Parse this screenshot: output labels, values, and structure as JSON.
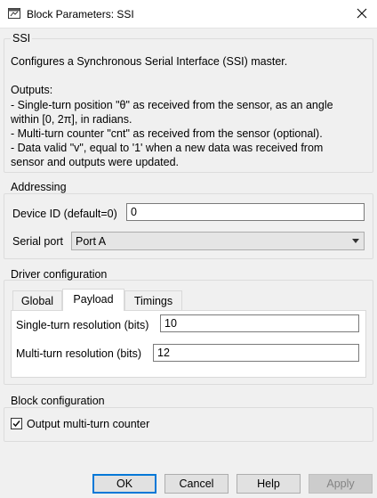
{
  "window": {
    "title": "Block Parameters: SSI",
    "icon": "simulink-block-icon",
    "close_icon": "close-icon"
  },
  "ssi": {
    "group_title": "SSI",
    "description": "Configures a Synchronous Serial Interface (SSI) master.\n\nOutputs:\n- Single-turn position \"θ\" as received from the sensor, as an angle\nwithin [0, 2π], in radians.\n- Multi-turn counter \"cnt\" as received from the sensor (optional).\n- Data valid \"v\", equal to '1' when a new data was received from\nsensor and outputs were updated."
  },
  "addressing": {
    "group_title": "Addressing",
    "device_id_label": "Device ID (default=0)",
    "device_id_value": "0",
    "serial_port_label": "Serial port",
    "serial_port_value": "Port A"
  },
  "driver": {
    "group_title": "Driver configuration",
    "tabs": [
      {
        "label": "Global",
        "active": false
      },
      {
        "label": "Payload",
        "active": true
      },
      {
        "label": "Timings",
        "active": false
      }
    ],
    "single_turn_label": "Single-turn resolution (bits)",
    "single_turn_value": "10",
    "multi_turn_label": "Multi-turn resolution (bits)",
    "multi_turn_value": "12"
  },
  "block_config": {
    "group_title": "Block configuration",
    "output_multiturn_label": "Output multi-turn counter",
    "output_multiturn_checked": true
  },
  "buttons": {
    "ok": "OK",
    "cancel": "Cancel",
    "help": "Help",
    "apply": "Apply"
  },
  "colors": {
    "default_button_border": "#0078d7",
    "background": "#f0f0f0"
  }
}
